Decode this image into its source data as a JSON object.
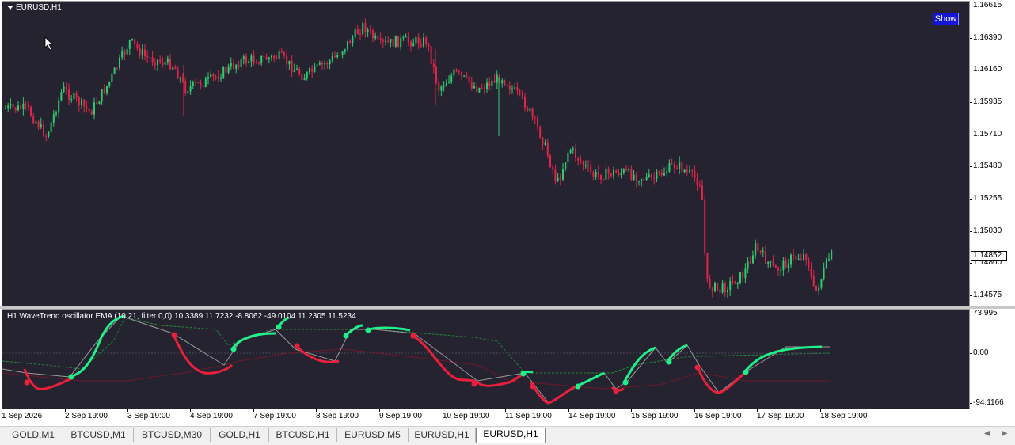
{
  "main_chart": {
    "symbol_label": "EURUSD,H1",
    "show_button": "Show",
    "price_levels": [
      "1.16615",
      "1.16390",
      "1.16160",
      "1.15935",
      "1.15710",
      "1.15480",
      "1.15255",
      "1.15030",
      "1.14800",
      "1.14575"
    ],
    "current_price": "1.14852"
  },
  "indicator": {
    "label": "H1 WaveTrend oscillator EMA (10,21, filter 0,0) 10.3389 11.7232 -8.8062 -49.0104 11.2305 11.5234",
    "levels": [
      "73.995",
      "0.00",
      "-94.1166"
    ]
  },
  "time_axis": [
    "1 Sep 2026",
    "2 Sep 19:00",
    "3 Sep 19:00",
    "4 Sep 19:00",
    "7 Sep 19:00",
    "8 Sep 19:00",
    "9 Sep 19:00",
    "10 Sep 19:00",
    "11 Sep 19:00",
    "14 Sep 19:00",
    "15 Sep 19:00",
    "16 Sep 19:00",
    "17 Sep 19:00",
    "18 Sep 19:00"
  ],
  "tabs": [
    {
      "label": "GOLD,M1",
      "active": false
    },
    {
      "label": "BTCUSD,M1",
      "active": false
    },
    {
      "label": "BTCUSD,M30",
      "active": false
    },
    {
      "label": "GOLD,H1",
      "active": false
    },
    {
      "label": "BTCUSD,H1",
      "active": false
    },
    {
      "label": "EURUSD,M5",
      "active": false
    },
    {
      "label": "EURUSD,H1",
      "active": false
    },
    {
      "label": "EURUSD,H1",
      "active": true
    }
  ],
  "colors": {
    "background": "#262330",
    "bull": "#2ecc71",
    "bear": "#e0244a",
    "wt_up": "#1ef08a",
    "wt_down": "#e8203c"
  },
  "icons": {
    "cursor": "mouse-pointer-icon",
    "dropdown": "triangle-down-icon",
    "scroll_left": "scroll-left-icon",
    "scroll_right": "scroll-right-icon"
  }
}
